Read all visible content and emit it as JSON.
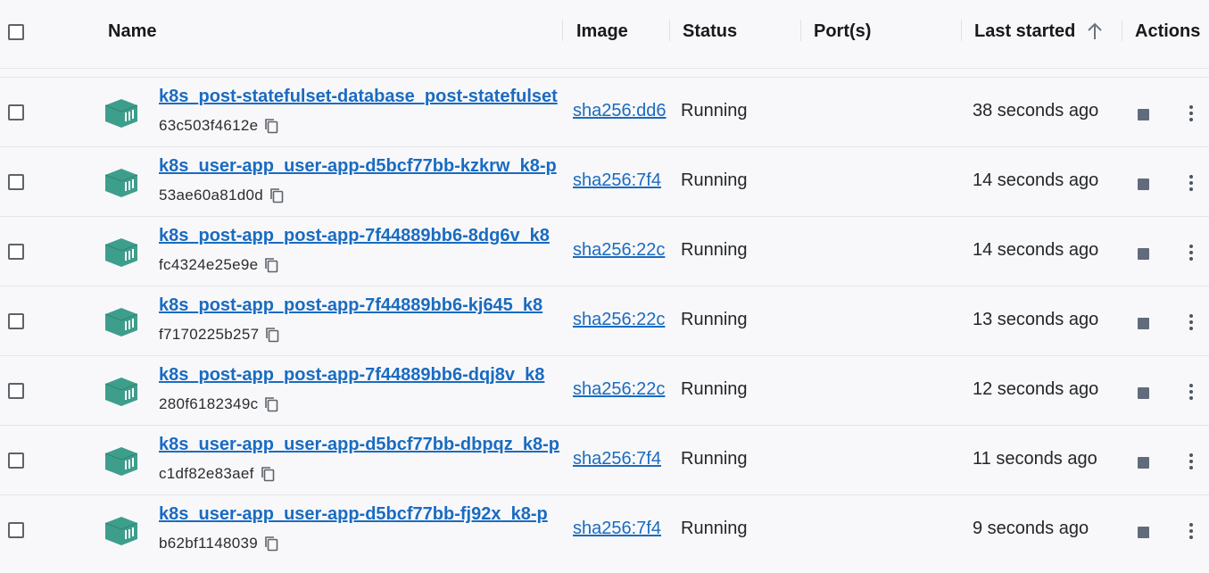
{
  "table": {
    "columns": {
      "name": "Name",
      "image": "Image",
      "status": "Status",
      "ports": "Port(s)",
      "last_started": "Last started",
      "actions": "Actions"
    },
    "sort": {
      "column": "last_started",
      "direction": "ascending",
      "icon": "arrow-up-icon"
    },
    "rows": [
      {
        "name": "k8s_post-statefulset-database_post-statefulset",
        "id": "63c503f4612e",
        "image": "sha256:dd6",
        "status": "Running",
        "ports": "",
        "last_started": "38 seconds ago"
      },
      {
        "name": "k8s_user-app_user-app-d5bcf77bb-kzkrw_k8-p",
        "id": "53ae60a81d0d",
        "image": "sha256:7f4",
        "status": "Running",
        "ports": "",
        "last_started": "14 seconds ago"
      },
      {
        "name": "k8s_post-app_post-app-7f44889bb6-8dg6v_k8",
        "id": "fc4324e25e9e",
        "image": "sha256:22c",
        "status": "Running",
        "ports": "",
        "last_started": "14 seconds ago"
      },
      {
        "name": "k8s_post-app_post-app-7f44889bb6-kj645_k8",
        "id": "f7170225b257",
        "image": "sha256:22c",
        "status": "Running",
        "ports": "",
        "last_started": "13 seconds ago"
      },
      {
        "name": "k8s_post-app_post-app-7f44889bb6-dqj8v_k8",
        "id": "280f6182349c",
        "image": "sha256:22c",
        "status": "Running",
        "ports": "",
        "last_started": "12 seconds ago"
      },
      {
        "name": "k8s_user-app_user-app-d5bcf77bb-dbpqz_k8-p",
        "id": "c1df82e83aef",
        "image": "sha256:7f4",
        "status": "Running",
        "ports": "",
        "last_started": "11 seconds ago"
      },
      {
        "name": "k8s_user-app_user-app-d5bcf77bb-fj92x_k8-p",
        "id": "b62bf1148039",
        "image": "sha256:7f4",
        "status": "Running",
        "ports": "",
        "last_started": "9 seconds ago"
      }
    ]
  },
  "icons": {
    "container": "container-icon",
    "copy": "copy-icon",
    "stop": "stop-icon",
    "more": "more-vertical-icon"
  },
  "colors": {
    "link": "#1a6bc1",
    "container_icon": "#3d9e8c",
    "stop_icon": "#616b7b",
    "background": "#f8f8fa"
  }
}
